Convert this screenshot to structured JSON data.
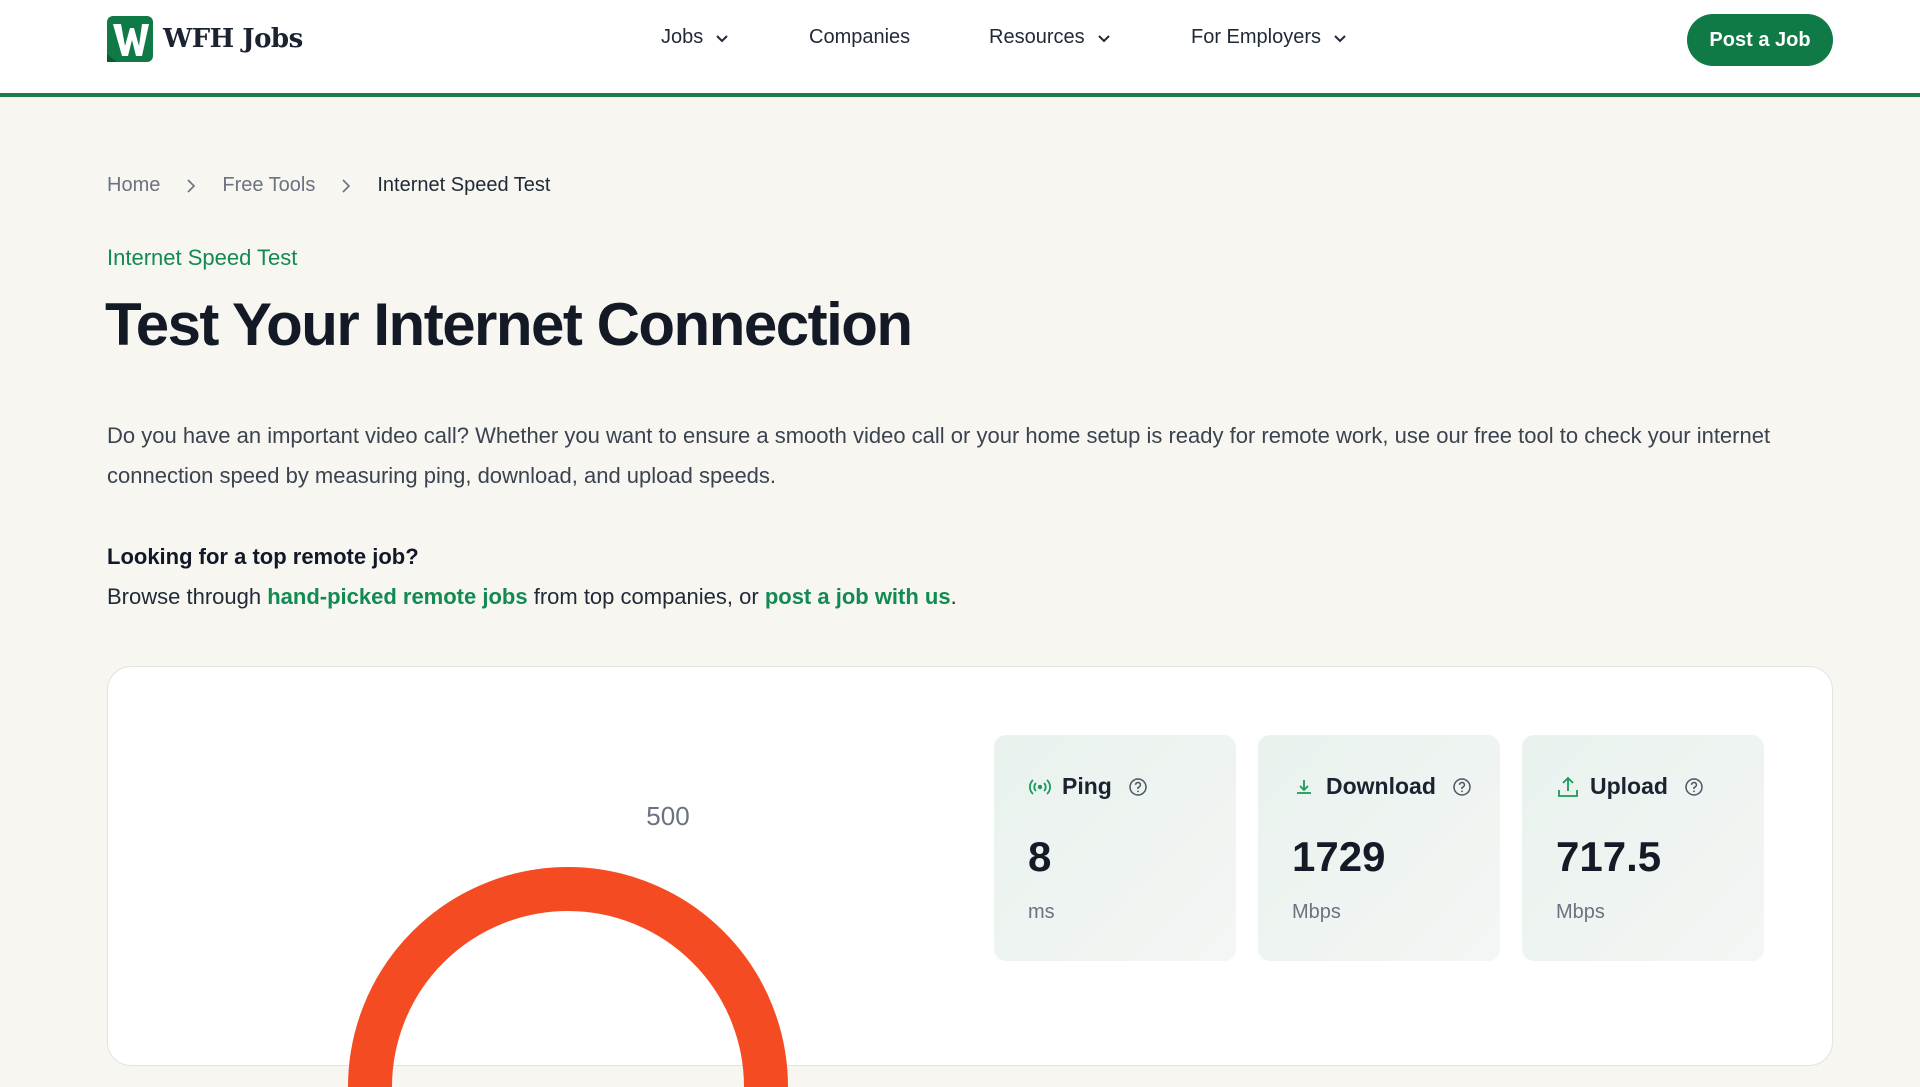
{
  "brand": {
    "name": "WFH Jobs",
    "logo_icon": "w-logo-icon",
    "accent": "#0f7a45"
  },
  "nav": {
    "items": [
      {
        "label": "Jobs",
        "has_dropdown": true
      },
      {
        "label": "Companies",
        "has_dropdown": false
      },
      {
        "label": "Resources",
        "has_dropdown": true
      },
      {
        "label": "For Employers",
        "has_dropdown": true
      }
    ],
    "cta": "Post a Job"
  },
  "breadcrumb": [
    "Home",
    "Free Tools",
    "Internet Speed Test"
  ],
  "page": {
    "eyebrow": "Internet Speed Test",
    "title": "Test Your Internet Connection",
    "description": "Do you have an important video call? Whether you want to ensure a smooth video call or your home setup is ready for remote work, use our free tool to check your internet connection speed by measuring ping, download, and upload speeds.",
    "promo_heading": "Looking for a top remote job?",
    "promo_prefix": "Browse through ",
    "promo_link1": "hand-picked remote jobs",
    "promo_middle": " from top companies, or ",
    "promo_link2": "post a job with us",
    "promo_suffix": "."
  },
  "speedtest": {
    "gauge_top_label": "500",
    "gauge_color": "#f44b22",
    "metrics": [
      {
        "title": "Ping",
        "value": "8",
        "unit": "ms",
        "icon": "signal-icon"
      },
      {
        "title": "Download",
        "value": "1729",
        "unit": "Mbps",
        "icon": "download-icon"
      },
      {
        "title": "Upload",
        "value": "717.5",
        "unit": "Mbps",
        "icon": "upload-icon"
      }
    ]
  }
}
